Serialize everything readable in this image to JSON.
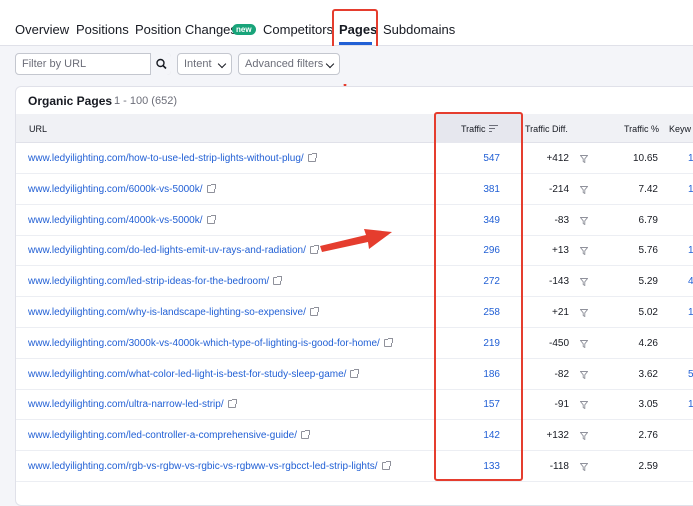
{
  "tabs": {
    "overview": "Overview",
    "positions": "Positions",
    "position_changes": "Position Changes",
    "new_badge": "new",
    "competitors": "Competitors",
    "pages": "Pages",
    "subdomains": "Subdomains"
  },
  "filters": {
    "url_placeholder": "Filter by URL",
    "intent": "Intent",
    "advanced": "Advanced filters"
  },
  "table": {
    "title": "Organic Pages",
    "range": "1 - 100 (652)",
    "headers": {
      "url": "URL",
      "traffic": "Traffic",
      "traffic_diff": "Traffic Diff.",
      "traffic_pct": "Traffic %",
      "keywords": "Keyw"
    },
    "rows": [
      {
        "url": "www.ledyilighting.com/how-to-use-led-strip-lights-without-plug/",
        "traffic": "547",
        "diff": "+412",
        "pct": "10.65",
        "kw": "1"
      },
      {
        "url": "www.ledyilighting.com/6000k-vs-5000k/",
        "traffic": "381",
        "diff": "-214",
        "pct": "7.42",
        "kw": "1"
      },
      {
        "url": "www.ledyilighting.com/4000k-vs-5000k/",
        "traffic": "349",
        "diff": "-83",
        "pct": "6.79",
        "kw": ""
      },
      {
        "url": "www.ledyilighting.com/do-led-lights-emit-uv-rays-and-radiation/",
        "traffic": "296",
        "diff": "+13",
        "pct": "5.76",
        "kw": "1"
      },
      {
        "url": "www.ledyilighting.com/led-strip-ideas-for-the-bedroom/",
        "traffic": "272",
        "diff": "-143",
        "pct": "5.29",
        "kw": "4"
      },
      {
        "url": "www.ledyilighting.com/why-is-landscape-lighting-so-expensive/",
        "traffic": "258",
        "diff": "+21",
        "pct": "5.02",
        "kw": "1"
      },
      {
        "url": "www.ledyilighting.com/3000k-vs-4000k-which-type-of-lighting-is-good-for-home/",
        "traffic": "219",
        "diff": "-450",
        "pct": "4.26",
        "kw": ""
      },
      {
        "url": "www.ledyilighting.com/what-color-led-light-is-best-for-study-sleep-game/",
        "traffic": "186",
        "diff": "-82",
        "pct": "3.62",
        "kw": "5"
      },
      {
        "url": "www.ledyilighting.com/ultra-narrow-led-strip/",
        "traffic": "157",
        "diff": "-91",
        "pct": "3.05",
        "kw": "1"
      },
      {
        "url": "www.ledyilighting.com/led-controller-a-comprehensive-guide/",
        "traffic": "142",
        "diff": "+132",
        "pct": "2.76",
        "kw": ""
      },
      {
        "url": "www.ledyilighting.com/rgb-vs-rgbw-vs-rgbic-vs-rgbww-vs-rgbcct-led-strip-lights/",
        "traffic": "133",
        "diff": "-118",
        "pct": "2.59",
        "kw": ""
      }
    ]
  },
  "colors": {
    "accent": "#2260d5",
    "annotation": "#e53d2e",
    "badge": "#19a47a"
  }
}
